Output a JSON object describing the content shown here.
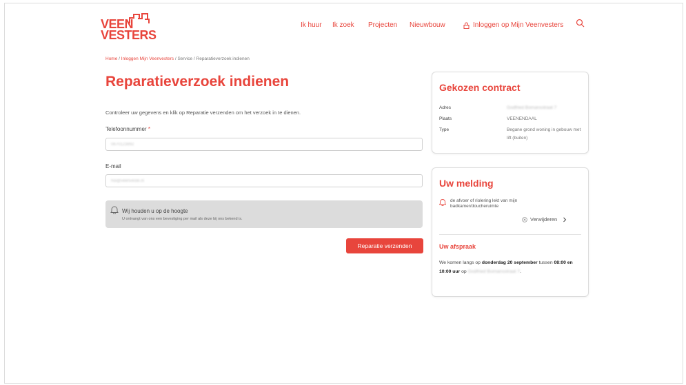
{
  "brand": {
    "line1": "VEEN",
    "line2": "VESTERS",
    "color": "#e8453c"
  },
  "nav": {
    "items": [
      "Ik huur",
      "Ik zoek",
      "Projecten",
      "Nieuwbouw"
    ],
    "login": "Inloggen op Mijn Veenvesters"
  },
  "breadcrumb": {
    "home": "Home",
    "login": "Inloggen Mijn Veenvesters",
    "service": "Service",
    "current": "Reparatieverzoek indienen"
  },
  "page": {
    "title": "Reparatieverzoek indienen",
    "intro": "Controleer uw gegevens en klik op Reparatie verzenden om het verzoek in te dienen."
  },
  "form": {
    "phone_label": "Telefoonnummer",
    "phone_required": "*",
    "phone_value": "0670123892",
    "email_label": "E-mail",
    "email_value": "hoi@veenveste.nl",
    "notice_title": "Wij houden u op de hoogte",
    "notice_text": "U ontvangt van ons een bevestiging per mail als deze bij ons bekend is.",
    "submit": "Reparatie verzenden"
  },
  "contract": {
    "title": "Gekozen contract",
    "rows": [
      {
        "label": "Adres",
        "value": "Godfried Bomansstraat 7"
      },
      {
        "label": "Plaats",
        "value": "VEENENDAAL"
      },
      {
        "label": "Type",
        "value": "Begane grond woning in gebouw met lift (buiten)"
      }
    ]
  },
  "melding": {
    "title": "Uw melding",
    "text": "de afvoer of riolering lekt van mijn badkamer/doucheruimte",
    "remove": "Verwijderen"
  },
  "afspraak": {
    "title": "Uw afspraak",
    "p1": "We komen langs op ",
    "date": "donderdag 20 september",
    "p2": " tussen ",
    "time": "08:00 en 10:00 uur",
    "p3": " op ",
    "address": "Godfried Bomansstraat 7",
    "p4": "."
  }
}
